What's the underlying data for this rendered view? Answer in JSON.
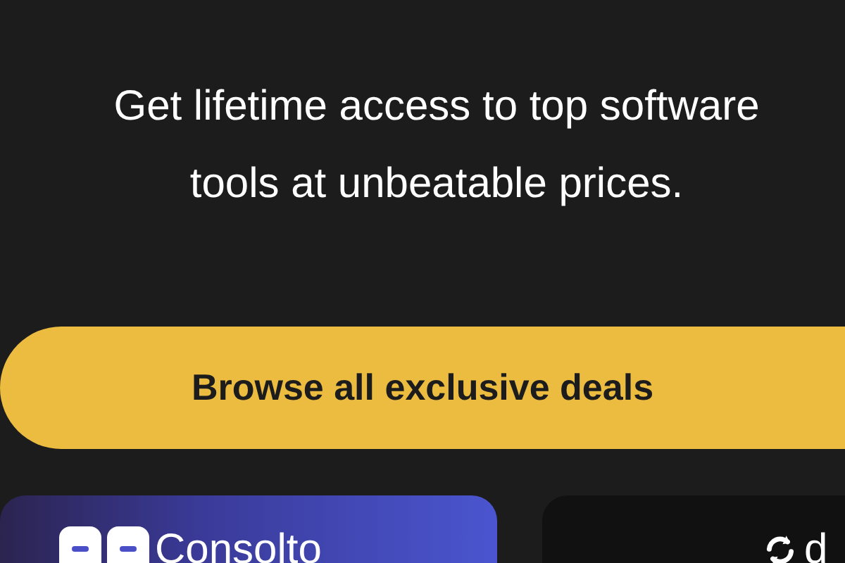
{
  "headline": "Get lifetime access to top software tools at unbeatable prices.",
  "cta_button": "Browse all exclusive deals",
  "deal_cards": [
    {
      "kind": "gradient",
      "logo_text": "Consolto"
    },
    {
      "kind": "dark",
      "logo_text": "d"
    }
  ]
}
